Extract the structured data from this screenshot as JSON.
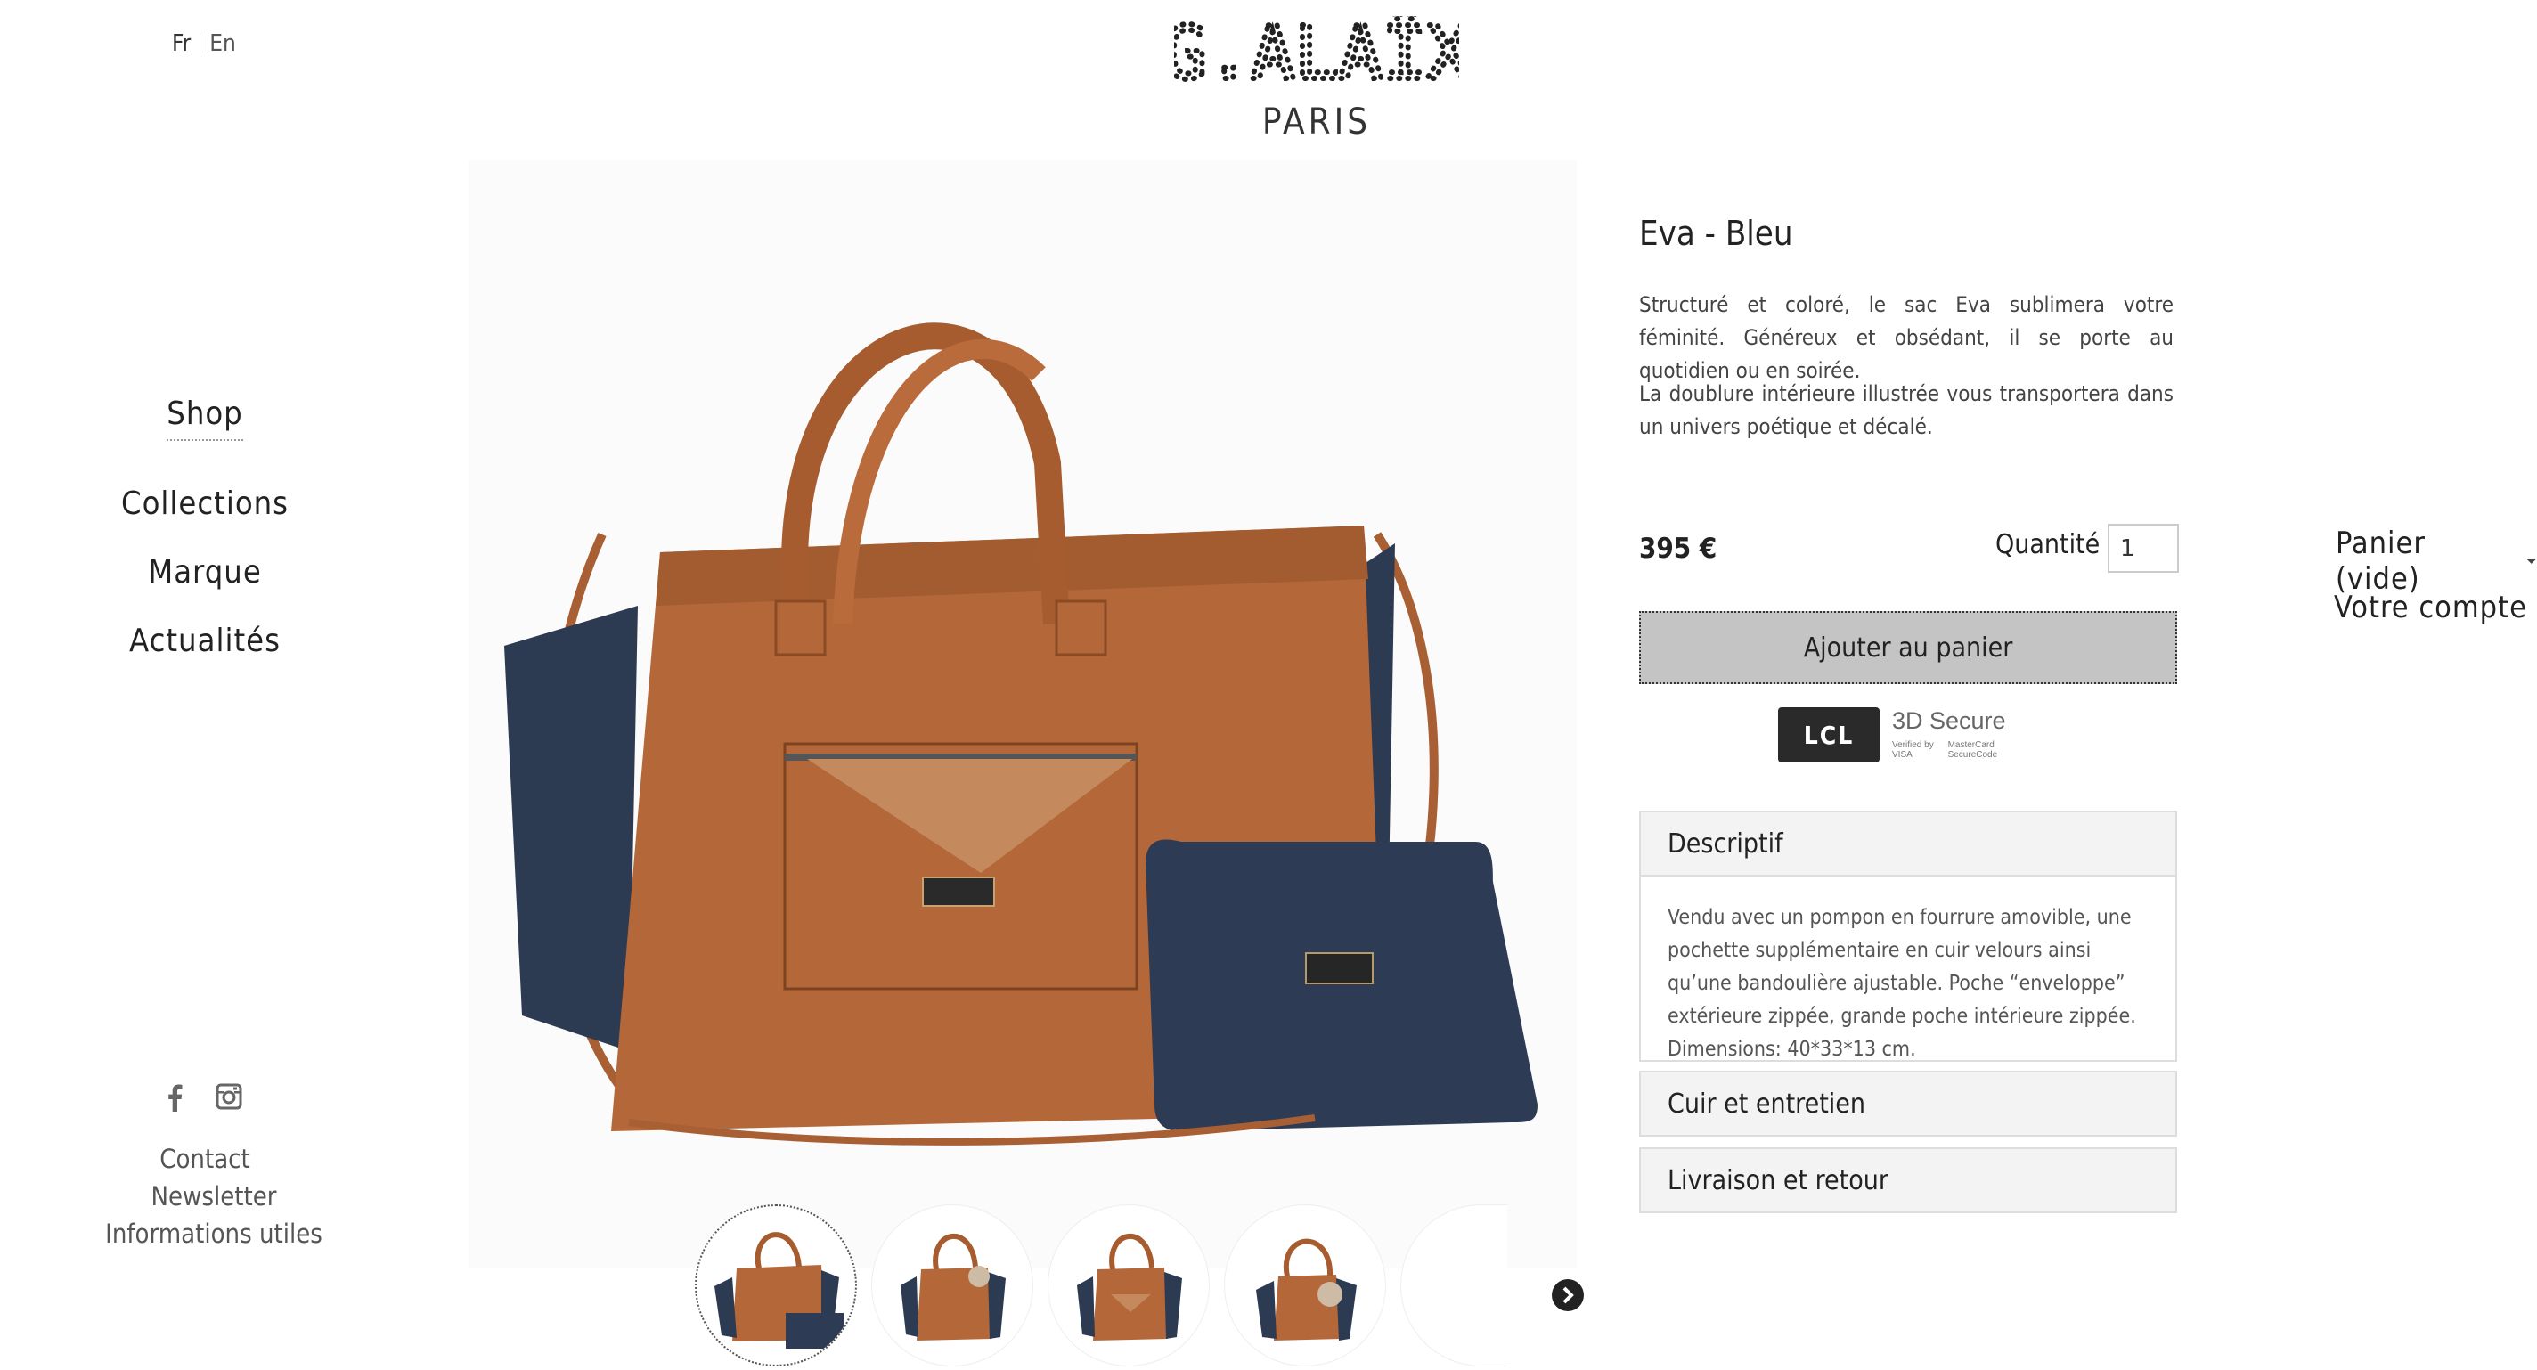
{
  "header": {
    "lang_fr": "Fr",
    "lang_en": "En",
    "logo_mark": "G.ALAÏX",
    "logo_sub": "PARIS"
  },
  "nav": {
    "shop": "Shop",
    "collections": "Collections",
    "marque": "Marque",
    "actualites": "Actualités"
  },
  "footer": {
    "contact": "Contact",
    "newsletter": "Newsletter",
    "informations": "Informations utiles",
    "social_icons": [
      "facebook-icon",
      "instagram-icon"
    ]
  },
  "product": {
    "title": "Eva - Bleu",
    "description_1": "Structuré et coloré, le sac Eva sublimera votre féminité. Généreux et obsédant, il se porte au quotidien ou en soirée.",
    "description_2": "La doublure intérieure illustrée vous transportera dans un univers poétique et décalé.",
    "price": "395 €",
    "quantity_label": "Quantité :",
    "quantity_value": "1",
    "add_to_cart": "Ajouter au panier",
    "payment": {
      "lcl": "LCL",
      "secure": "3D Secure",
      "verified": "Verified by VISA",
      "mastercard": "MasterCard SecureCode"
    },
    "accordion": {
      "descriptif": "Descriptif",
      "descriptif_body": "Vendu avec un pompon en fourrure amovible, une pochette supplémentaire en cuir velours ainsi qu’une bandoulière ajustable. Poche “enveloppe” extérieure zippée, grande poche intérieure zippée. Dimensions: 40*33*13 cm.",
      "cuir": "Cuir et entretien",
      "livraison": "Livraison et retour"
    }
  },
  "account": {
    "cart": "Panier (vide)",
    "account": "Votre compte"
  },
  "colors": {
    "leather": "#b4683a",
    "denim": "#2c3a52",
    "button_gray": "#c4c4c4",
    "accordion_bg": "#f3f3f3"
  }
}
